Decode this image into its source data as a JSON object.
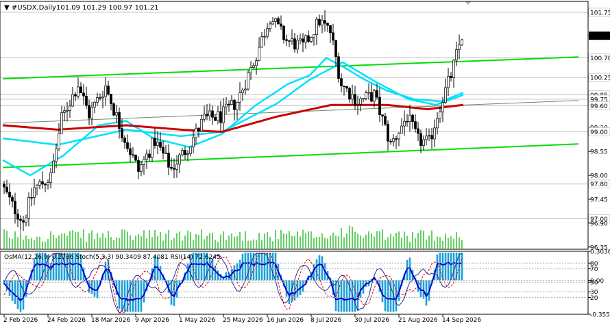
{
  "chart_data": {
    "type": "candlestick",
    "symbol": "#USDX,Daily",
    "ohlc_header": [
      "101.09",
      "101.29",
      "100.97",
      "101.21"
    ],
    "price_axis": {
      "ylim": [
        96.3,
        102.0
      ],
      "tick_labels": [
        "101.75",
        "101.21",
        "100.70",
        "100.25",
        "99.85",
        "99.75",
        "99.60",
        "99.10",
        "99.00",
        "98.55",
        "98.00",
        "97.80",
        "97.45",
        "97.00",
        "96.90",
        "96.35"
      ],
      "tick_values": [
        101.75,
        101.21,
        100.7,
        100.25,
        99.85,
        99.75,
        99.6,
        99.1,
        99.0,
        98.55,
        98.0,
        97.8,
        97.45,
        97.0,
        96.9,
        96.35
      ],
      "highlighted": [
        "101.21"
      ],
      "boxed": [
        "101.75",
        "100.70",
        "100.25",
        "99.85",
        "99.75",
        "99.60",
        "99.00",
        "97.80",
        "97.00"
      ]
    },
    "x_tick_labels": [
      "2 Feb 2026",
      "24 Feb 2026",
      "18 Mar 2026",
      "9 Apr 2026",
      "1 May 2026",
      "25 May 2026",
      "16 Jun 2026",
      "8 Jul 2026",
      "30 Jul 2026",
      "21 Aug 2026",
      "14 Sep 2026"
    ],
    "x_tick_index": [
      0,
      16,
      32,
      48,
      64,
      80,
      96,
      112,
      128,
      144,
      160
    ],
    "bar_count": 168,
    "anchors": [
      {
        "i": 0,
        "v": 97.8
      },
      {
        "i": 4,
        "v": 97.3
      },
      {
        "i": 8,
        "v": 96.95
      },
      {
        "i": 12,
        "v": 97.7
      },
      {
        "i": 18,
        "v": 97.95
      },
      {
        "i": 22,
        "v": 99.3
      },
      {
        "i": 28,
        "v": 100.1
      },
      {
        "i": 32,
        "v": 99.4
      },
      {
        "i": 38,
        "v": 100.05
      },
      {
        "i": 44,
        "v": 99.0
      },
      {
        "i": 50,
        "v": 98.1
      },
      {
        "i": 56,
        "v": 98.8
      },
      {
        "i": 62,
        "v": 98.15
      },
      {
        "i": 68,
        "v": 98.65
      },
      {
        "i": 74,
        "v": 99.3
      },
      {
        "i": 80,
        "v": 99.35
      },
      {
        "i": 86,
        "v": 99.7
      },
      {
        "i": 92,
        "v": 100.6
      },
      {
        "i": 98,
        "v": 101.65
      },
      {
        "i": 104,
        "v": 101.1
      },
      {
        "i": 110,
        "v": 100.95
      },
      {
        "i": 116,
        "v": 101.55
      },
      {
        "i": 120,
        "v": 101.3
      },
      {
        "i": 124,
        "v": 100.1
      },
      {
        "i": 130,
        "v": 99.7
      },
      {
        "i": 136,
        "v": 99.85
      },
      {
        "i": 142,
        "v": 98.7
      },
      {
        "i": 148,
        "v": 99.35
      },
      {
        "i": 152,
        "v": 98.8
      },
      {
        "i": 156,
        "v": 98.75
      },
      {
        "i": 160,
        "v": 99.6
      },
      {
        "i": 164,
        "v": 100.3
      },
      {
        "i": 168,
        "v": 101.21
      }
    ],
    "ema_red": [
      {
        "i": 0,
        "v": 99.15
      },
      {
        "i": 20,
        "v": 99.05
      },
      {
        "i": 45,
        "v": 99.15
      },
      {
        "i": 65,
        "v": 99.05
      },
      {
        "i": 80,
        "v": 99.0
      },
      {
        "i": 100,
        "v": 99.35
      },
      {
        "i": 120,
        "v": 99.62
      },
      {
        "i": 140,
        "v": 99.62
      },
      {
        "i": 155,
        "v": 99.52
      },
      {
        "i": 168,
        "v": 99.62
      }
    ],
    "ema_cyan": [
      {
        "i": 0,
        "v": 98.85
      },
      {
        "i": 20,
        "v": 98.7
      },
      {
        "i": 45,
        "v": 99.05
      },
      {
        "i": 65,
        "v": 98.9
      },
      {
        "i": 80,
        "v": 99.0
      },
      {
        "i": 100,
        "v": 99.65
      },
      {
        "i": 112,
        "v": 100.2
      },
      {
        "i": 124,
        "v": 100.6
      },
      {
        "i": 136,
        "v": 100.15
      },
      {
        "i": 148,
        "v": 99.75
      },
      {
        "i": 158,
        "v": 99.62
      },
      {
        "i": 168,
        "v": 99.85
      }
    ],
    "ema_cyan_fast": [
      {
        "i": 0,
        "v": 98.35
      },
      {
        "i": 10,
        "v": 98.0
      },
      {
        "i": 22,
        "v": 98.45
      },
      {
        "i": 35,
        "v": 99.15
      },
      {
        "i": 45,
        "v": 99.25
      },
      {
        "i": 55,
        "v": 98.85
      },
      {
        "i": 68,
        "v": 98.65
      },
      {
        "i": 80,
        "v": 98.95
      },
      {
        "i": 92,
        "v": 99.6
      },
      {
        "i": 104,
        "v": 100.1
      },
      {
        "i": 112,
        "v": 100.3
      },
      {
        "i": 118,
        "v": 100.7
      },
      {
        "i": 124,
        "v": 100.5
      },
      {
        "i": 132,
        "v": 100.2
      },
      {
        "i": 140,
        "v": 99.95
      },
      {
        "i": 150,
        "v": 99.75
      },
      {
        "i": 160,
        "v": 99.7
      },
      {
        "i": 168,
        "v": 99.9
      }
    ],
    "trend_lines": [
      {
        "p1": {
          "i": 0,
          "v": 100.22
        },
        "p2": {
          "i": 210,
          "v": 100.72
        }
      },
      {
        "p1": {
          "i": 0,
          "v": 98.18
        },
        "p2": {
          "i": 210,
          "v": 98.72
        }
      },
      {
        "p1": {
          "i": 0,
          "v": 99.2
        },
        "p2": {
          "i": 210,
          "v": 99.72
        },
        "thin": true
      }
    ],
    "oscillator": {
      "header": "OsMA(12,26,9) 0.2736  Stoch(5,3,3) 90.3409 87.4081  RSI(14) 72.6245",
      "tick_labels": [
        "0.3036",
        "80",
        "70",
        "0.00",
        "50",
        "30",
        "20",
        "-0.3551"
      ],
      "tick_values": [
        0.3036,
        0.18,
        0.12,
        0.0,
        -0.02,
        -0.12,
        -0.18,
        -0.3551
      ],
      "ylim": [
        -0.3551,
        0.3036
      ]
    },
    "colors": {
      "bull": "#000000",
      "bear": "#000000",
      "volume": "#00b000",
      "ema_red": "#cc0000",
      "ema_cyan": "#00e0ff",
      "trend": "#00dd00",
      "osma": "#1aa0d8",
      "rsi": "#0000cc",
      "stoch_main": "#2a2a8a",
      "stoch_signal": "#cc0000",
      "grid": "#c0c0c0"
    }
  }
}
